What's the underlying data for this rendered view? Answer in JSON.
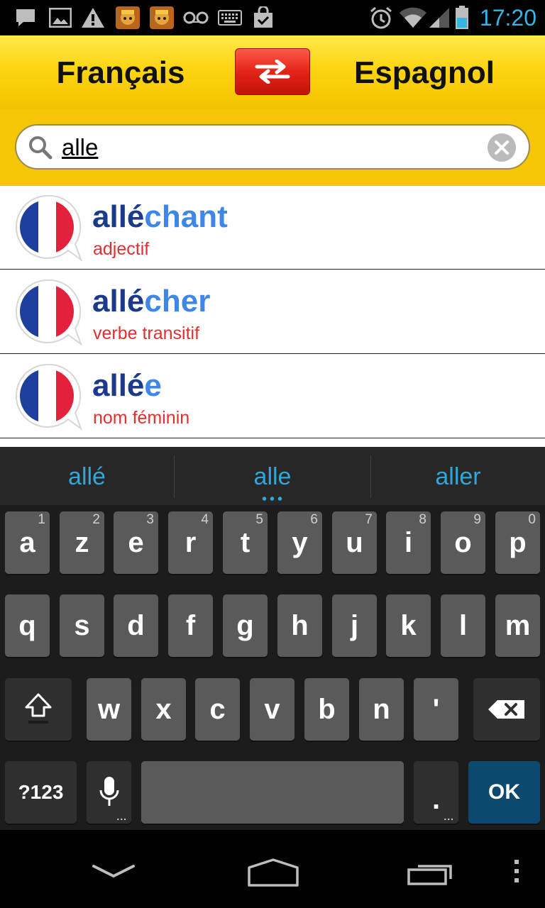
{
  "status_bar": {
    "time": "17:20",
    "left_icons": [
      "message-icon",
      "image-icon",
      "warning-icon",
      "game-icon",
      "game-icon",
      "voicemail-icon",
      "keyboard-icon",
      "shopping-bag-icon"
    ],
    "right_icons": [
      "alarm-icon",
      "wifi-icon",
      "signal-icon",
      "battery-icon"
    ]
  },
  "header": {
    "source_language": "Français",
    "target_language": "Espagnol",
    "swap_icon": "swap-arrows-icon"
  },
  "search": {
    "value": "alle",
    "clear_icon": "clear-icon"
  },
  "results": [
    {
      "match": "allé",
      "rest": "chant",
      "pos": "adjectif",
      "flag": "flag-france-icon"
    },
    {
      "match": "allé",
      "rest": "cher",
      "pos": "verbe transitif",
      "flag": "flag-france-icon"
    },
    {
      "match": "allé",
      "rest": "e",
      "pos": "nom féminin",
      "flag": "flag-france-icon"
    }
  ],
  "keyboard": {
    "suggestions": [
      "allé",
      "alle",
      "aller"
    ],
    "row1": [
      {
        "key": "a",
        "hint": "1"
      },
      {
        "key": "z",
        "hint": "2"
      },
      {
        "key": "e",
        "hint": "3"
      },
      {
        "key": "r",
        "hint": "4"
      },
      {
        "key": "t",
        "hint": "5"
      },
      {
        "key": "y",
        "hint": "6"
      },
      {
        "key": "u",
        "hint": "7"
      },
      {
        "key": "i",
        "hint": "8"
      },
      {
        "key": "o",
        "hint": "9"
      },
      {
        "key": "p",
        "hint": "0"
      }
    ],
    "row2": [
      "q",
      "s",
      "d",
      "f",
      "g",
      "h",
      "j",
      "k",
      "l",
      "m"
    ],
    "row3": [
      "w",
      "x",
      "c",
      "v",
      "b",
      "n",
      "'"
    ],
    "symbols_label": "?123",
    "period_label": ".",
    "ok_label": "OK",
    "more_indicator": "..."
  },
  "navbar": {
    "icons": [
      "hide-keyboard-icon",
      "home-icon",
      "recents-icon",
      "menu-icon"
    ]
  }
}
